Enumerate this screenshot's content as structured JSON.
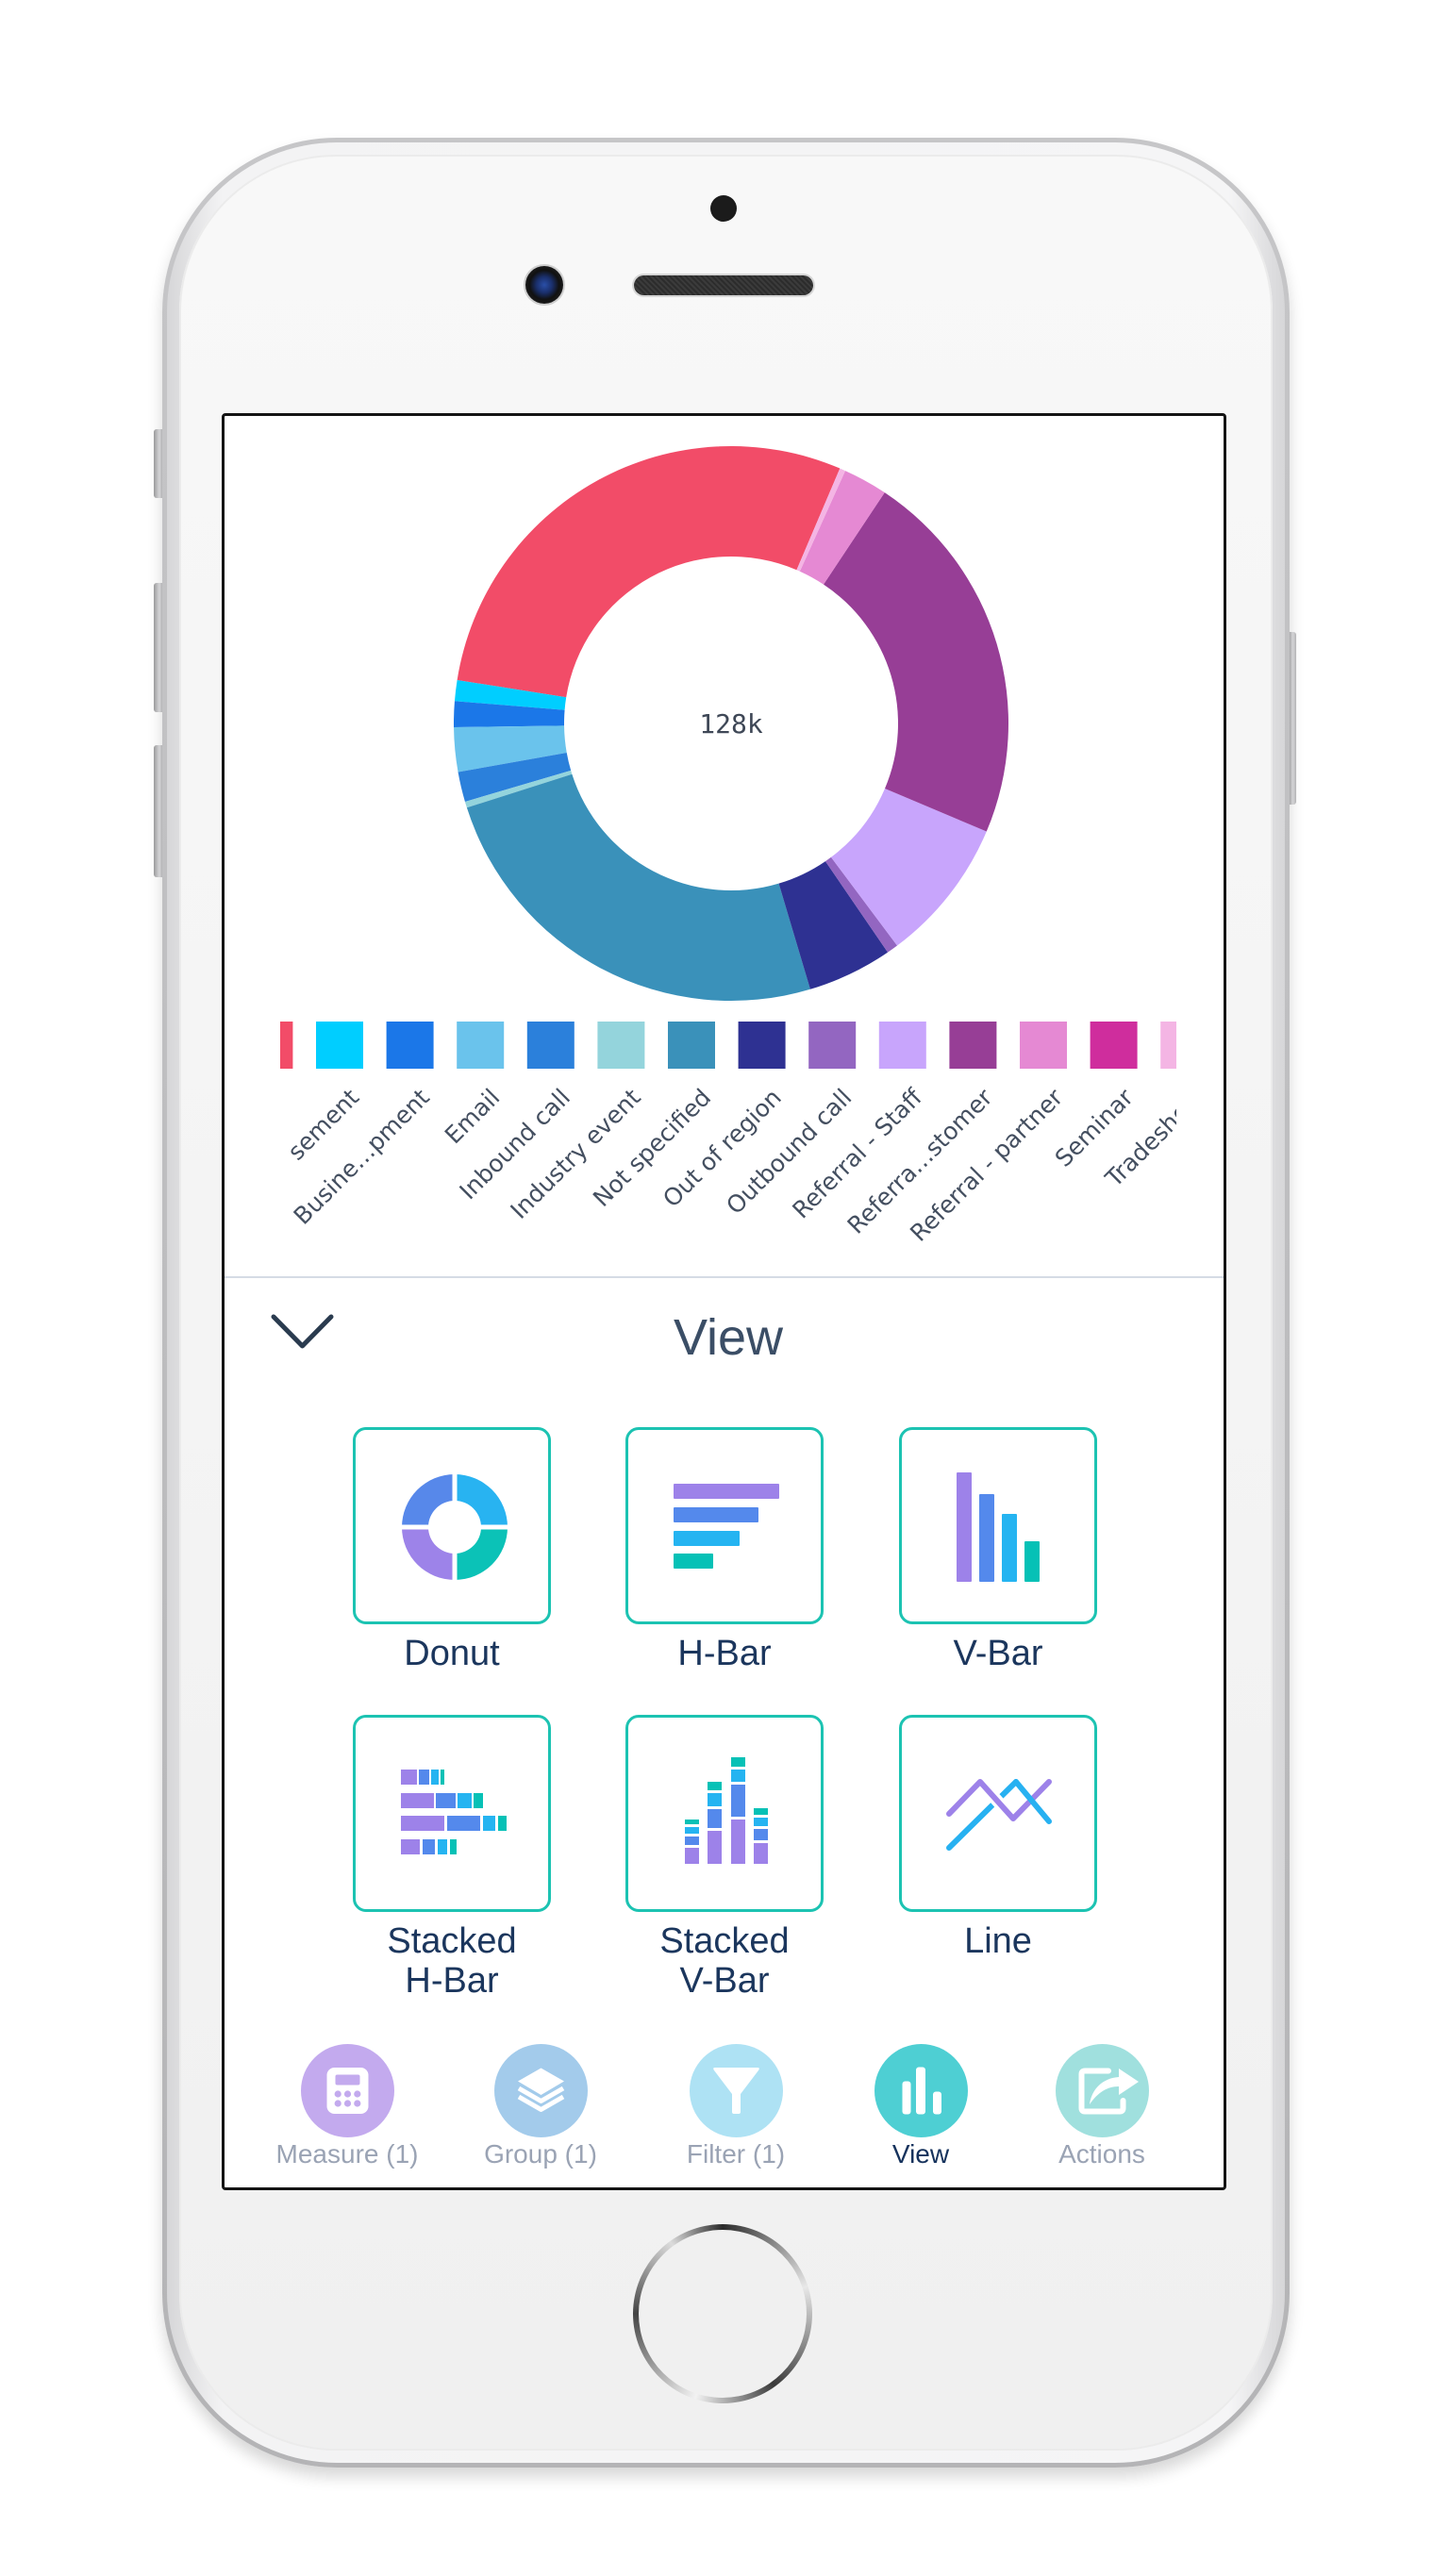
{
  "chart_data": {
    "type": "pie",
    "variant": "donut",
    "title": "",
    "center_label": "128k",
    "total": 128000,
    "categories": [
      "",
      "sement",
      "Busine…pment",
      "Email",
      "Inbound call",
      "Industry event",
      "Not specified",
      "Out of region",
      "Outbound call",
      "Referral - Staff",
      "Referra…stomer",
      "Referral - partner",
      "Seminar",
      "Tradesho"
    ],
    "values": [
      37010,
      1560,
      1920,
      3310,
      2240,
      460,
      31610,
      6330,
      850,
      10770,
      28200,
      3310,
      0,
      430
    ],
    "colors": [
      "#F24C68",
      "#00CEFF",
      "#1B77E8",
      "#6AC3EC",
      "#2B80DB",
      "#94D4DC",
      "#3A91BA",
      "#2E3192",
      "#9366C1",
      "#C8A5FC",
      "#973E96",
      "#E589D3",
      "#CF2D9D",
      "#F4B5E4"
    ],
    "legend": "bottom"
  },
  "view_panel": {
    "collapse_icon": "chevron-down-icon",
    "title": "View",
    "accent_color": "#1CC3B2",
    "options": [
      {
        "label_lines": [
          "Donut"
        ],
        "icon": "donut-chart-icon"
      },
      {
        "label_lines": [
          "H-Bar"
        ],
        "icon": "horizontal-bar-chart-icon"
      },
      {
        "label_lines": [
          "V-Bar"
        ],
        "icon": "vertical-bar-chart-icon"
      },
      {
        "label_lines": [
          "Stacked",
          "H-Bar"
        ],
        "icon": "stacked-horizontal-bar-chart-icon"
      },
      {
        "label_lines": [
          "Stacked",
          "V-Bar"
        ],
        "icon": "stacked-vertical-bar-chart-icon"
      },
      {
        "label_lines": [
          "Line"
        ],
        "icon": "line-chart-icon"
      }
    ]
  },
  "bottom_nav": {
    "items": [
      {
        "label": "Measure (1)",
        "icon": "calculator-icon",
        "color": "#C3AAEE",
        "active": false
      },
      {
        "label": "Group (1)",
        "icon": "layers-icon",
        "color": "#A3CBEB",
        "active": false
      },
      {
        "label": "Filter (1)",
        "icon": "filter-funnel-icon",
        "color": "#AEE2F4",
        "active": false
      },
      {
        "label": "View",
        "icon": "bar-chart-icon",
        "color": "#4ECFD3",
        "active": true
      },
      {
        "label": "Actions",
        "icon": "share-icon",
        "color": "#A0E0DE",
        "active": false
      }
    ]
  }
}
